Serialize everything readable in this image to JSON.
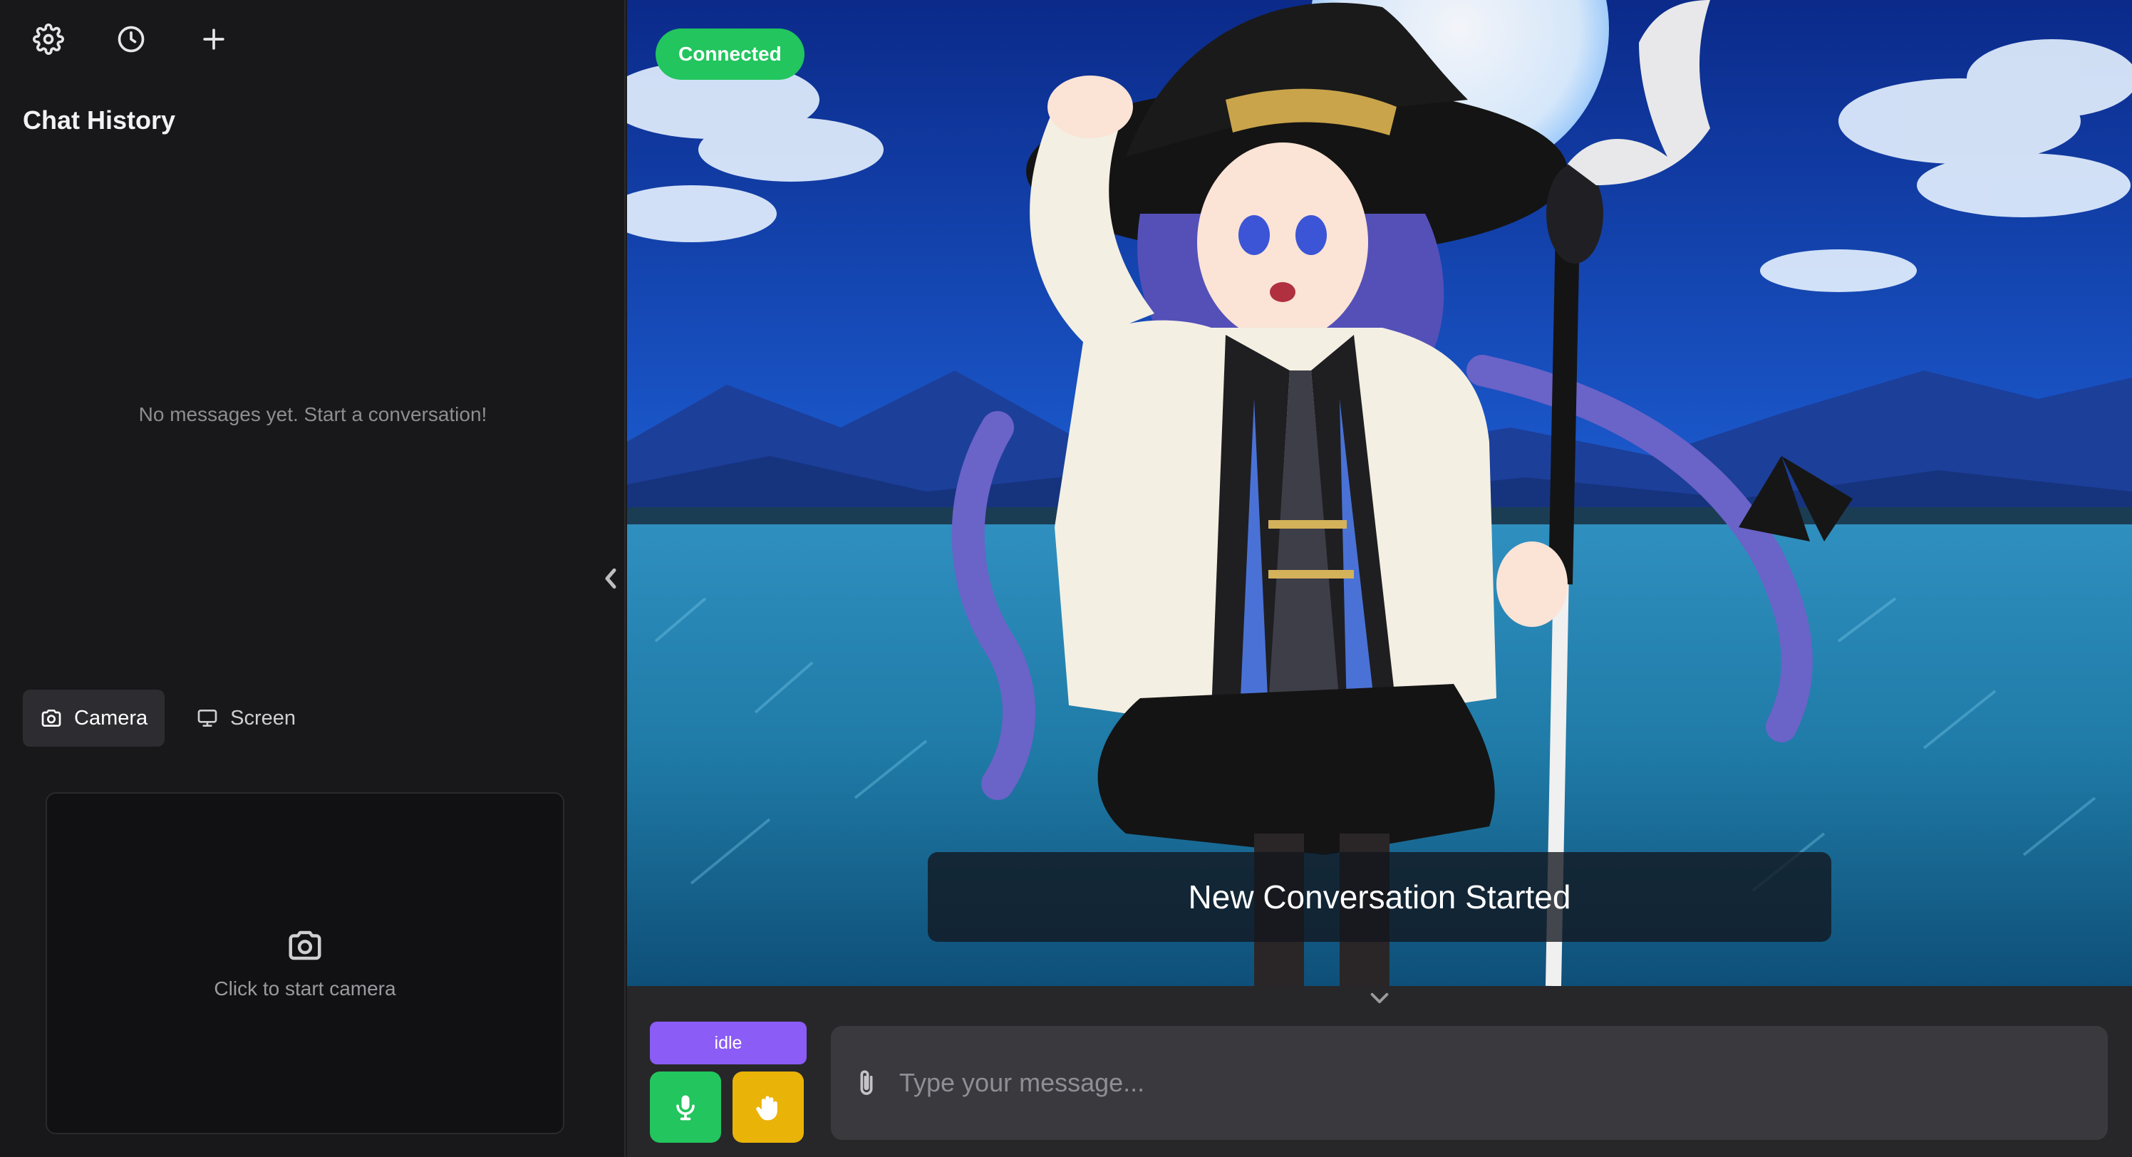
{
  "sidebar": {
    "toolbar": {
      "settings_icon": "gear-icon",
      "history_icon": "clock-icon",
      "new_chat_icon": "plus-icon"
    },
    "title": "Chat History",
    "empty_message": "No messages yet. Start a conversation!",
    "media_tabs": [
      {
        "label": "Camera",
        "icon": "camera-icon",
        "active": true
      },
      {
        "label": "Screen",
        "icon": "monitor-icon",
        "active": false
      }
    ],
    "camera_placeholder": "Click to start camera"
  },
  "stage": {
    "connection_status": "Connected",
    "subtitle": "New Conversation Started"
  },
  "controls": {
    "state_label": "idle",
    "message_placeholder": "Type your message..."
  },
  "colors": {
    "connected": "#22c55e",
    "state_badge": "#8b5cf6",
    "mic_button": "#22c55e",
    "interrupt_button": "#eab308",
    "sidebar_bg": "#18181a",
    "input_bg": "#3a3a3e"
  }
}
